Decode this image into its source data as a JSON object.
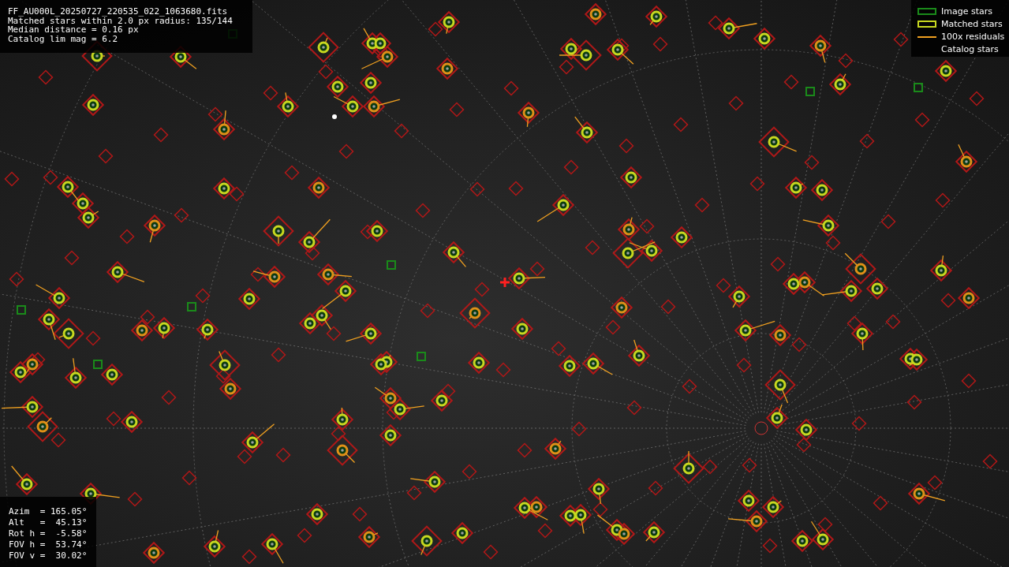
{
  "header": {
    "lines": [
      "FF_AU000L_20250727_220535_022_1063680.fits",
      "Matched stars within 2.0 px radius: 135/144",
      "Median distance = 0.16 px",
      "Catalog lim mag = 6.2"
    ]
  },
  "legend": [
    {
      "kind": "image",
      "label": "Image stars"
    },
    {
      "kind": "matched",
      "label": "Matched stars"
    },
    {
      "kind": "residual",
      "label": "100x residuals"
    },
    {
      "kind": "catalog",
      "label": "Catalog stars"
    }
  ],
  "pointing": {
    "lines": [
      "Azim  = 165.05°",
      "Alt   =  45.13°",
      "Rot h =  -5.58°",
      "FOV h =  53.74°",
      "FOV v =  30.02°"
    ]
  }
}
